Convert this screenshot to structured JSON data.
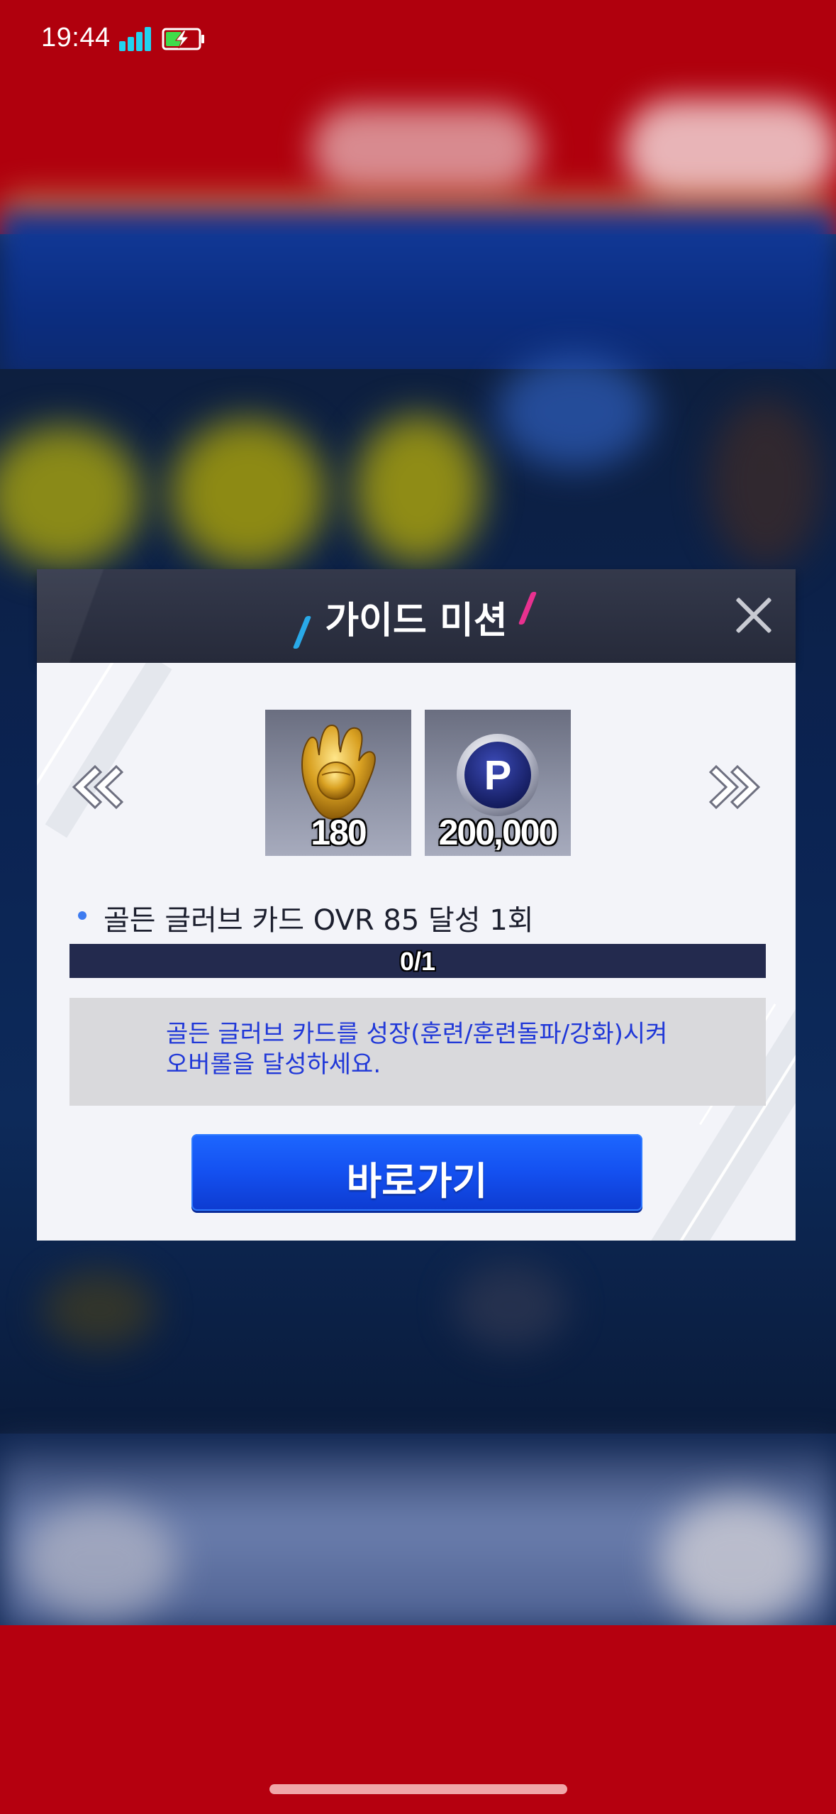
{
  "status_bar": {
    "time": "19:44",
    "signal_icon": "signal-bars-icon",
    "battery_icon": "battery-charging-icon"
  },
  "modal": {
    "title": "가이드 미션",
    "close_icon": "close-icon",
    "prev_icon": "double-chevron-left-icon",
    "next_icon": "double-chevron-right-icon",
    "rewards": [
      {
        "icon": "golden-glove-icon",
        "count": "180"
      },
      {
        "icon": "points-coin-icon",
        "count": "200,000"
      }
    ],
    "mission": {
      "text": "골든 글러브 카드 OVR 85 달성 1회",
      "progress_text": "0/1",
      "progress_fraction": 0
    },
    "description": "골든 글러브 카드를 성장(훈련/훈련돌파/강화)시켜\n오버롤을 달성하세요.",
    "go_button_label": "바로가기"
  },
  "colors": {
    "header_bg": "#2c3142",
    "body_bg": "#f3f4f9",
    "progress_bg": "#232a4e",
    "description_text": "#2038d8",
    "button_blue": "#1450f0",
    "accent_cyan": "#29a9e8",
    "accent_pink": "#e8318f",
    "background_red": "#b0000d"
  }
}
